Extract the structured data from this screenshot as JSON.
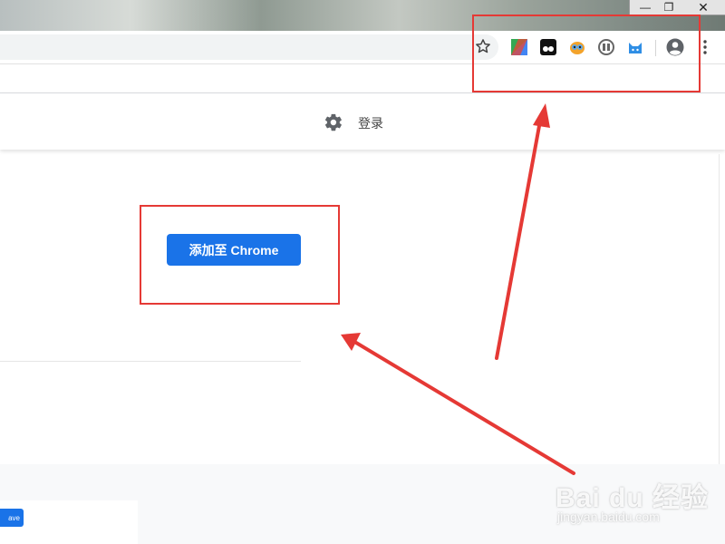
{
  "window": {
    "minimize_glyph": "—",
    "maximize_glyph": "❐",
    "close_glyph": "✕"
  },
  "toolbar": {
    "bookmark_icon": "star-icon",
    "extensions": [
      {
        "name": "google-drive-icon"
      },
      {
        "name": "tampermonkey-icon"
      },
      {
        "name": "owl-extension-icon"
      },
      {
        "name": "reader-extension-icon"
      },
      {
        "name": "cat-extension-icon"
      }
    ],
    "profile_icon": "account-circle-icon",
    "menu_icon": "kebab-menu-icon"
  },
  "header": {
    "settings_icon": "gear-icon",
    "login_label": "登录"
  },
  "main": {
    "add_button_label": "添加至 Chrome",
    "save_button_label": "ave"
  },
  "watermark": {
    "brand": "Bai du 经验",
    "url": "jingyan.baidu.com"
  },
  "colors": {
    "primary_blue": "#1a73e8",
    "annotation_red": "#e53935"
  }
}
